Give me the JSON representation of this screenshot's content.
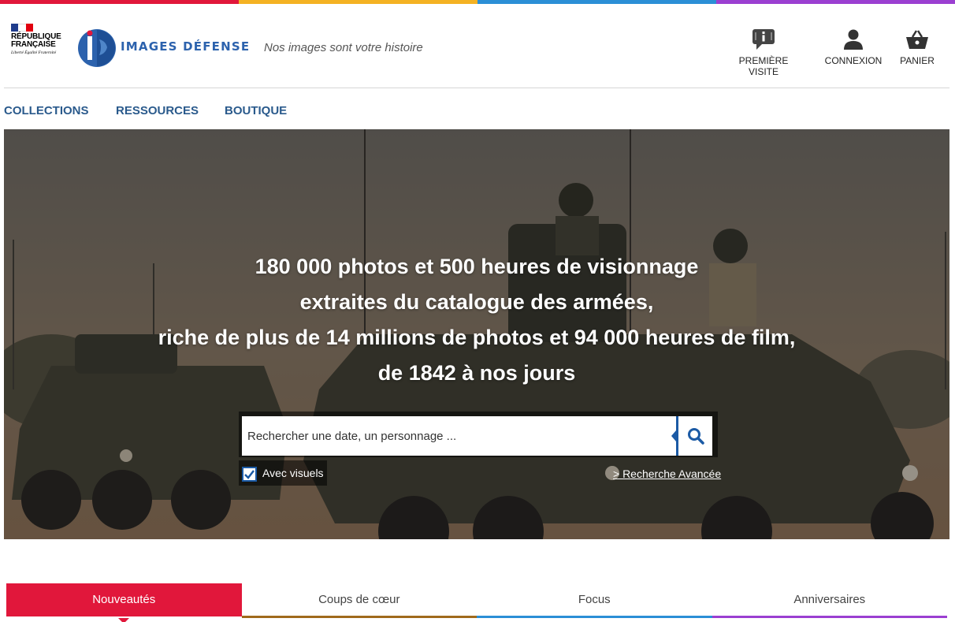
{
  "colors": {
    "brand_blue": "#2c62ad",
    "accent_red": "#e1173b",
    "stripe": [
      "#e1173b",
      "#f4b223",
      "#2b8fd6",
      "#9b3fd1"
    ]
  },
  "header": {
    "republique_line1": "RÉPUBLIQUE",
    "republique_line2": "FRANÇAISE",
    "devise": "Liberté Égalité Fraternité",
    "logo_text": "IMAGES DÉFENSE",
    "tagline": "Nos images sont votre histoire",
    "buttons": [
      {
        "label": "PREMIÈRE VISITE",
        "icon": "info-icon"
      },
      {
        "label": "CONNEXION",
        "icon": "user-icon"
      },
      {
        "label": "PANIER",
        "icon": "basket-icon"
      }
    ]
  },
  "nav": {
    "items": [
      "COLLECTIONS",
      "RESSOURCES",
      "BOUTIQUE"
    ]
  },
  "hero": {
    "line1": "180 000 photos et 500 heures de visionnage",
    "line2": "extraites du catalogue des armées,",
    "line3": "riche de plus de 14 millions de photos et 94 000 heures de film,",
    "line4": "de 1842 à nos jours",
    "search_placeholder": "Rechercher une date, un personnage ...",
    "search_icon": "search-icon",
    "checkbox_label": "Avec visuels",
    "checkbox_checked": true,
    "advanced_link": "> Recherche Avancée"
  },
  "tabs": [
    {
      "label": "Nouveautés",
      "active": true
    },
    {
      "label": "Coups de cœur",
      "active": false
    },
    {
      "label": "Focus",
      "active": false
    },
    {
      "label": "Anniversaires",
      "active": false
    }
  ]
}
